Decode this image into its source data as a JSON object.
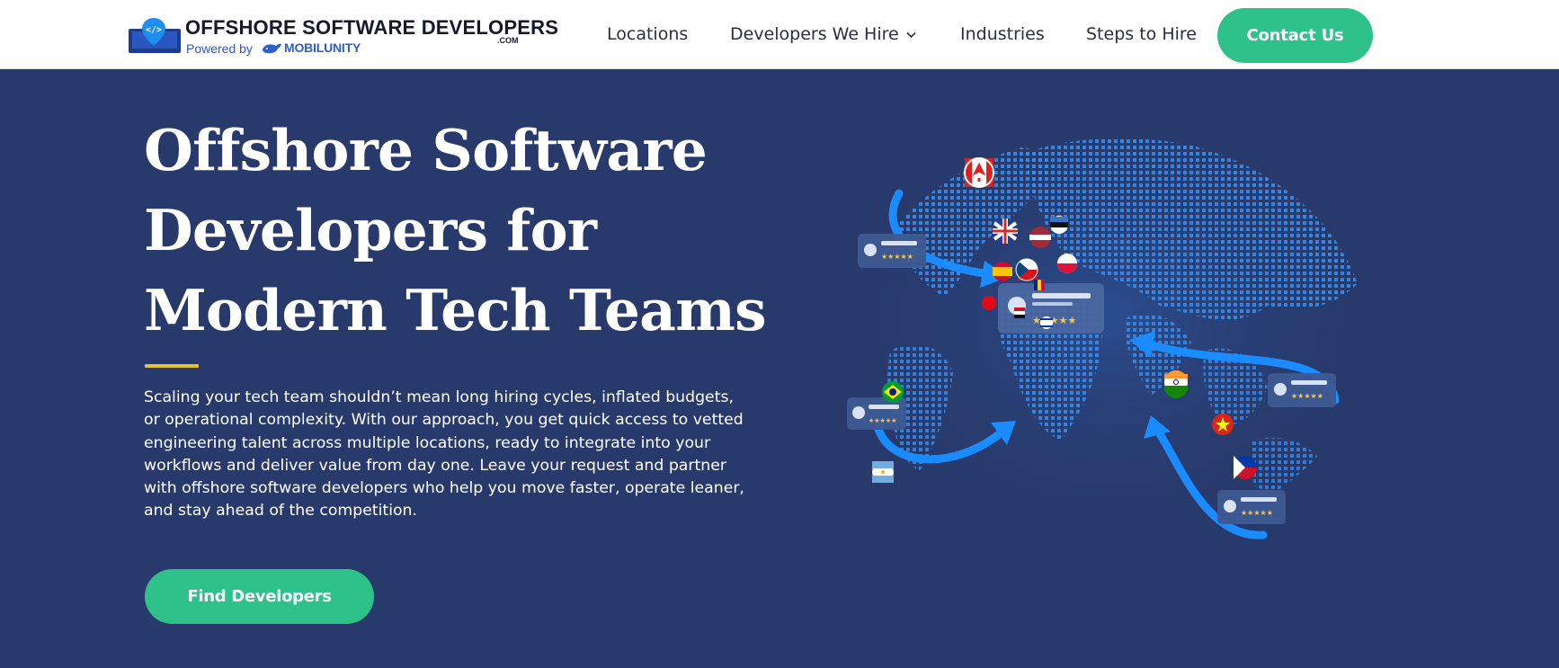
{
  "header": {
    "logo": {
      "title": "OFFSHORE SOFTWARE DEVELOPERS",
      "suffix": ".COM",
      "powered_by": "Powered by",
      "brand": "MOBILUNITY"
    },
    "nav": [
      {
        "label": "Locations"
      },
      {
        "label": "Developers We Hire",
        "has_dropdown": true
      },
      {
        "label": "Industries"
      },
      {
        "label": "Steps to Hire"
      }
    ],
    "contact_label": "Contact Us"
  },
  "hero": {
    "title_lines": [
      "Offshore Software",
      "Developers for",
      "Modern Tech Teams"
    ],
    "description": "Scaling your tech team shouldn’t mean long hiring cycles, inflated budgets, or operational complexity. With our approach, you get quick access to vetted engineering talent across multiple locations, ready to integrate into your workflows and deliver value from day one. Leave your request and partner with offshore software developers who help you move faster, operate leaner, and stay ahead of the competition.",
    "cta_label": "Find Developers"
  },
  "colors": {
    "background": "#283a6b",
    "accent_green": "#2ec28a",
    "accent_yellow": "#e6c12e",
    "globe_blue": "#2f7de0"
  },
  "icons": [
    "location-code-pin-icon",
    "whale-icon",
    "chevron-down-icon",
    "user-avatar-icon",
    "star-icon"
  ]
}
